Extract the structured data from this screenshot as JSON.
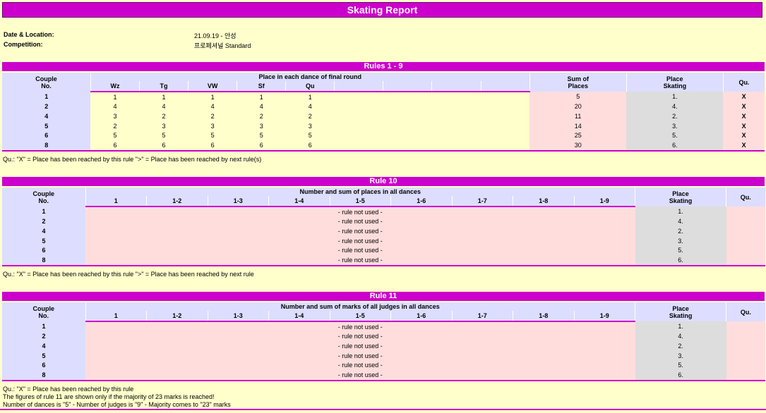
{
  "title": "Skating Report",
  "info": {
    "date_label": "Date & Location:",
    "date_value": "21.09.19  -  안성",
    "competition_label": "Competition:",
    "competition_value": "프로페셔널  Standard"
  },
  "rules19": {
    "title": "Rules 1 - 9",
    "couple_header_1": "Couple",
    "couple_header_2": "No.",
    "place_header": "Place in each dance of final round",
    "dances": [
      "Wz",
      "Tg",
      "VW",
      "Sf",
      "Qu",
      "",
      "",
      "",
      ""
    ],
    "sum_header_1": "Sum of",
    "sum_header_2": "Places",
    "place_skating_1": "Place",
    "place_skating_2": "Skating",
    "qu_header": "Qu.",
    "rows": [
      {
        "couple": "1",
        "places": [
          "1",
          "1",
          "1",
          "1",
          "1"
        ],
        "sum": "5",
        "place": "1.",
        "qu": "X"
      },
      {
        "couple": "2",
        "places": [
          "4",
          "4",
          "4",
          "4",
          "4"
        ],
        "sum": "20",
        "place": "4.",
        "qu": "X"
      },
      {
        "couple": "4",
        "places": [
          "3",
          "2",
          "2",
          "2",
          "2"
        ],
        "sum": "11",
        "place": "2.",
        "qu": "X"
      },
      {
        "couple": "5",
        "places": [
          "2",
          "3",
          "3",
          "3",
          "3"
        ],
        "sum": "14",
        "place": "3.",
        "qu": "X"
      },
      {
        "couple": "6",
        "places": [
          "5",
          "5",
          "5",
          "5",
          "5"
        ],
        "sum": "25",
        "place": "5.",
        "qu": "X"
      },
      {
        "couple": "8",
        "places": [
          "6",
          "6",
          "6",
          "6",
          "6"
        ],
        "sum": "30",
        "place": "6.",
        "qu": "X"
      }
    ],
    "note": "Qu.: \"X\" = Place has been reached by this rule     \">\" = Place has been reached by next rule(s)"
  },
  "rule10": {
    "title": "Rule 10",
    "couple_header_1": "Couple",
    "couple_header_2": "No.",
    "header": "Number and sum of places in all dances",
    "columns": [
      "1",
      "1-2",
      "1-3",
      "1-4",
      "1-5",
      "1-6",
      "1-7",
      "1-8",
      "1-9"
    ],
    "place_skating_1": "Place",
    "place_skating_2": "Skating",
    "qu_header": "Qu.",
    "rows": [
      {
        "couple": "1",
        "text": "- rule not used -",
        "place": "1."
      },
      {
        "couple": "2",
        "text": "- rule not used -",
        "place": "4."
      },
      {
        "couple": "4",
        "text": "- rule not used -",
        "place": "2."
      },
      {
        "couple": "5",
        "text": "- rule not used -",
        "place": "3."
      },
      {
        "couple": "6",
        "text": "- rule not used -",
        "place": "5."
      },
      {
        "couple": "8",
        "text": "- rule not used -",
        "place": "6."
      }
    ],
    "note": "Qu.: \"X\" = Place has been reached by this rule     \">\" = Place has been reached by next rule"
  },
  "rule11": {
    "title": "Rule 11",
    "couple_header_1": "Couple",
    "couple_header_2": "No.",
    "header": "Number and sum of marks of all judges in all dances",
    "columns": [
      "1",
      "1-2",
      "1-3",
      "1-4",
      "1-5",
      "1-6",
      "1-7",
      "1-8",
      "1-9"
    ],
    "place_skating_1": "Place",
    "place_skating_2": "Skating",
    "qu_header": "Qu.",
    "rows": [
      {
        "couple": "1",
        "text": "- rule not used -",
        "place": "1."
      },
      {
        "couple": "2",
        "text": "- rule not used -",
        "place": "4."
      },
      {
        "couple": "4",
        "text": "- rule not used -",
        "place": "2."
      },
      {
        "couple": "5",
        "text": "- rule not used -",
        "place": "3."
      },
      {
        "couple": "6",
        "text": "- rule not used -",
        "place": "5."
      },
      {
        "couple": "8",
        "text": "- rule not used -",
        "place": "6."
      }
    ],
    "note1": "Qu.: \"X\" = Place has been reached by this rule",
    "note2": "The figures of rule 11 are shown only if the majority of 23 marks is reached!",
    "note3": "Number of dances is \"5\"   -   Number of judges is \"9\"   -   Majority comes to \"23\" marks"
  }
}
